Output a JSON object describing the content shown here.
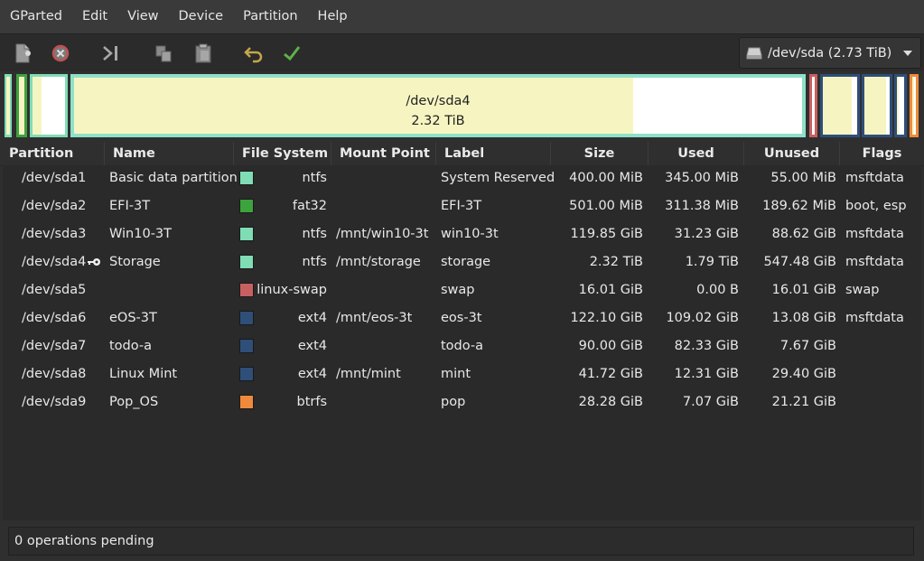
{
  "menu": [
    "GParted",
    "Edit",
    "View",
    "Device",
    "Partition",
    "Help"
  ],
  "toolbar": {
    "icons": [
      "new-partition-icon",
      "delete-icon",
      "resize-move-icon",
      "copy-icon",
      "paste-icon",
      "undo-icon",
      "apply-icon"
    ]
  },
  "device": {
    "label": "/dev/sda (2.73 TiB)"
  },
  "map": {
    "selected": {
      "name": "/dev/sda4",
      "size": "2.32 TiB"
    }
  },
  "columns": [
    "Partition",
    "Name",
    "File System",
    "Mount Point",
    "Label",
    "Size",
    "Used",
    "Unused",
    "Flags"
  ],
  "rows": [
    {
      "partition": "/dev/sda1",
      "name": "Basic data partition",
      "fs": "ntfs",
      "fs_color": "#7fdcb5",
      "mount": "",
      "label": "System Reserved",
      "size": "400.00 MiB",
      "used": "345.00 MiB",
      "unused": "55.00 MiB",
      "flags": "msftdata",
      "mounted": false
    },
    {
      "partition": "/dev/sda2",
      "name": "EFI-3T",
      "fs": "fat32",
      "fs_color": "#3da33d",
      "mount": "",
      "label": "EFI-3T",
      "size": "501.00 MiB",
      "used": "311.38 MiB",
      "unused": "189.62 MiB",
      "flags": "boot, esp",
      "mounted": false
    },
    {
      "partition": "/dev/sda3",
      "name": "Win10-3T",
      "fs": "ntfs",
      "fs_color": "#7fdcb5",
      "mount": "/mnt/win10-3t",
      "label": "win10-3t",
      "size": "119.85 GiB",
      "used": "31.23 GiB",
      "unused": "88.62 GiB",
      "flags": "msftdata",
      "mounted": false
    },
    {
      "partition": "/dev/sda4",
      "name": "Storage",
      "fs": "ntfs",
      "fs_color": "#7fdcb5",
      "mount": "/mnt/storage",
      "label": "storage",
      "size": "2.32 TiB",
      "used": "1.79 TiB",
      "unused": "547.48 GiB",
      "flags": "msftdata",
      "mounted": true
    },
    {
      "partition": "/dev/sda5",
      "name": "",
      "fs": "linux-swap",
      "fs_color": "#c76060",
      "mount": "",
      "label": "swap",
      "size": "16.01 GiB",
      "used": "0.00 B",
      "unused": "16.01 GiB",
      "flags": "swap",
      "mounted": false
    },
    {
      "partition": "/dev/sda6",
      "name": "eOS-3T",
      "fs": "ext4",
      "fs_color": "#2f4f78",
      "mount": "/mnt/eos-3t",
      "label": "eos-3t",
      "size": "122.10 GiB",
      "used": "109.02 GiB",
      "unused": "13.08 GiB",
      "flags": "msftdata",
      "mounted": false
    },
    {
      "partition": "/dev/sda7",
      "name": "todo-a",
      "fs": "ext4",
      "fs_color": "#2f4f78",
      "mount": "",
      "label": "todo-a",
      "size": "90.00 GiB",
      "used": "82.33 GiB",
      "unused": "7.67 GiB",
      "flags": "",
      "mounted": false
    },
    {
      "partition": "/dev/sda8",
      "name": "Linux Mint",
      "fs": "ext4",
      "fs_color": "#2f4f78",
      "mount": "/mnt/mint",
      "label": "mint",
      "size": "41.72 GiB",
      "used": "12.31 GiB",
      "unused": "29.40 GiB",
      "flags": "",
      "mounted": false
    },
    {
      "partition": "/dev/sda9",
      "name": "Pop_OS",
      "fs": "btrfs",
      "fs_color": "#ef8a3c",
      "mount": "",
      "label": "pop",
      "size": "28.28 GiB",
      "used": "7.07 GiB",
      "unused": "21.21 GiB",
      "flags": "",
      "mounted": false
    }
  ],
  "status": {
    "text": "0 operations pending"
  },
  "colors": {
    "used": "#f6f5c2",
    "unused": "#ffffff",
    "selected_border": "#8fe0c8",
    "background": "#2f2f2f"
  }
}
